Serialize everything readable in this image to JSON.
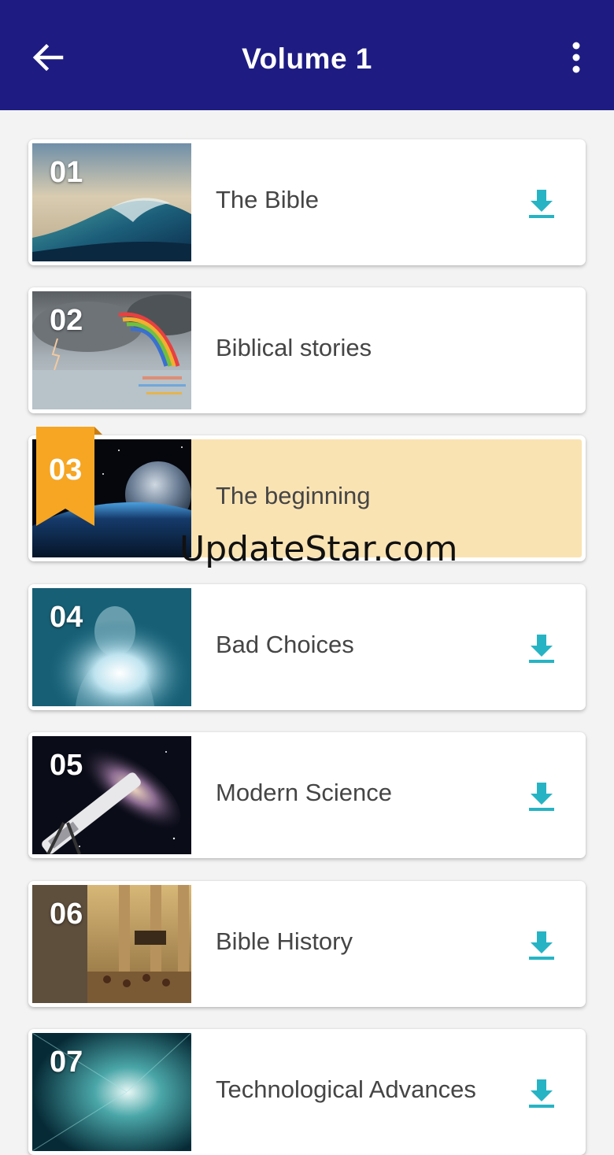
{
  "appbar": {
    "title": "Volume 1",
    "back_icon": "arrow-left-icon",
    "menu_icon": "more-vert-icon",
    "color": "#1e1c82"
  },
  "items": [
    {
      "number": "01",
      "title": "The Bible",
      "image": "ocean-wave",
      "download": true
    },
    {
      "number": "02",
      "title": "Biblical stories",
      "image": "rainbow-storm-sea",
      "download": true
    },
    {
      "number": "03",
      "title": "The beginning",
      "image": "earth-from-space",
      "download": false,
      "current": true
    },
    {
      "number": "04",
      "title": "Bad Choices",
      "image": "glowing-figure",
      "download": true
    },
    {
      "number": "05",
      "title": "Modern Science",
      "image": "telescope-galaxy",
      "download": true
    },
    {
      "number": "06",
      "title": "Bible History",
      "image": "ancient-egypt-scene",
      "download": true
    },
    {
      "number": "07",
      "title": "Technological Advances",
      "image": "digital-tunnel",
      "download": true
    }
  ],
  "colors": {
    "accent": "#26b4c4",
    "highlight": "#fae3b3",
    "bookmark": "#f6a623"
  },
  "watermark": "UpdateStar.com"
}
